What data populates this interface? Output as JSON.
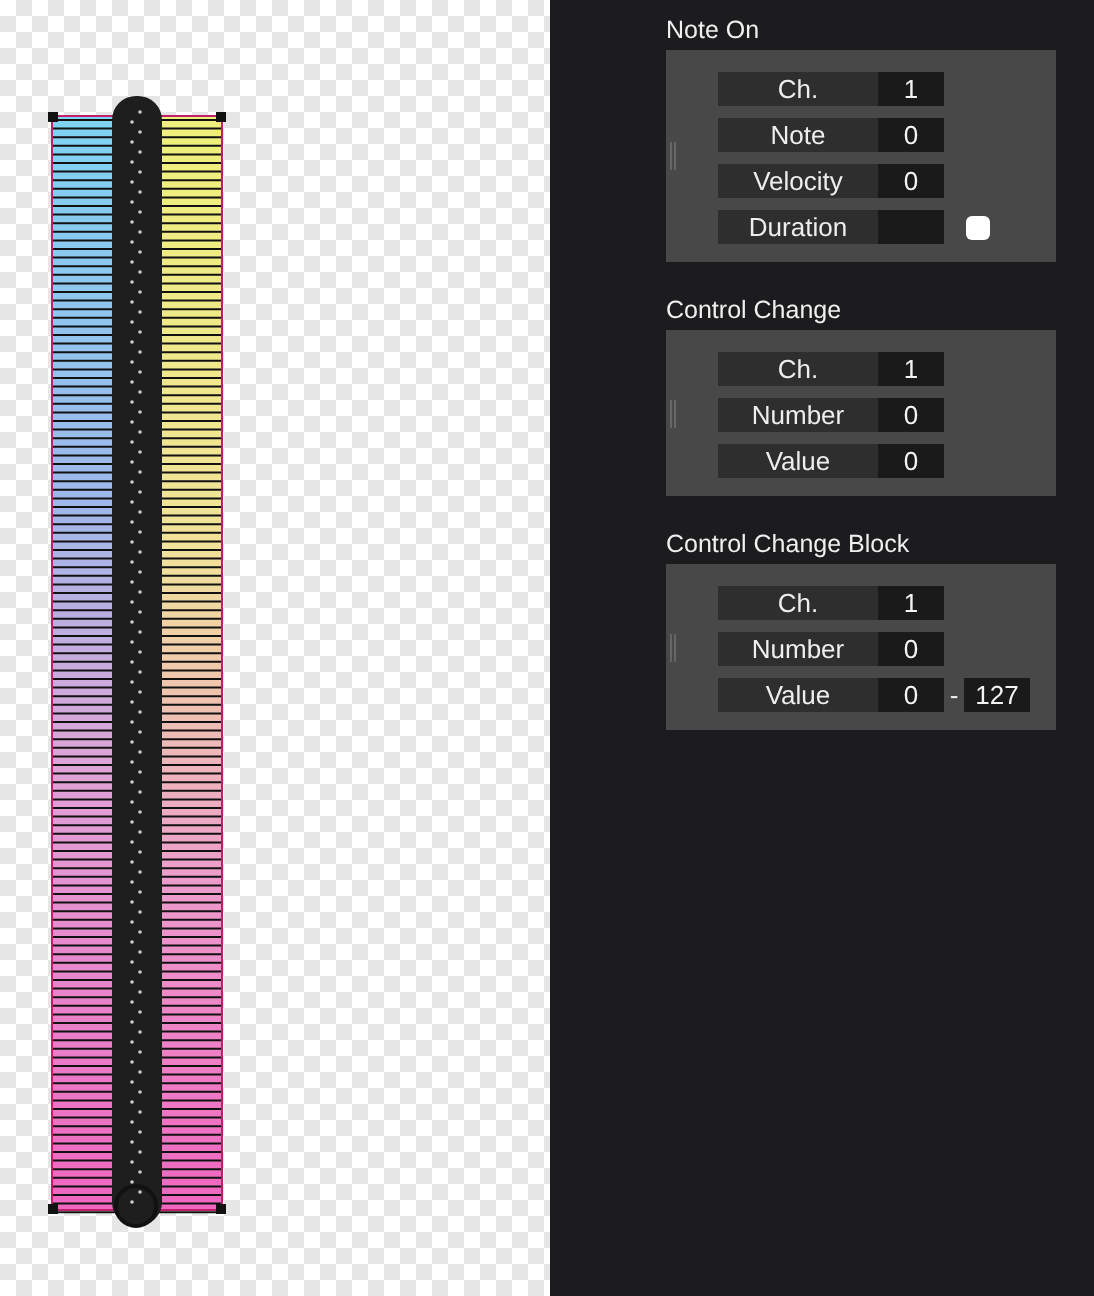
{
  "sections": [
    {
      "title": "Note On",
      "rows": [
        {
          "kind": "number",
          "label": "Ch.",
          "value": "1"
        },
        {
          "kind": "number",
          "label": "Note",
          "value": "0"
        },
        {
          "kind": "number",
          "label": "Velocity",
          "value": "0"
        },
        {
          "kind": "toggle",
          "label": "Duration",
          "checked": false
        }
      ]
    },
    {
      "title": "Control Change",
      "rows": [
        {
          "kind": "number",
          "label": "Ch.",
          "value": "1"
        },
        {
          "kind": "number",
          "label": "Number",
          "value": "0"
        },
        {
          "kind": "number",
          "label": "Value",
          "value": "0"
        }
      ]
    },
    {
      "title": "Control Change Block",
      "rows": [
        {
          "kind": "number",
          "label": "Ch.",
          "value": "1"
        },
        {
          "kind": "number",
          "label": "Number",
          "value": "0"
        },
        {
          "kind": "range",
          "label": "Value",
          "value": "0",
          "separator": "-",
          "max": "127"
        }
      ]
    }
  ]
}
